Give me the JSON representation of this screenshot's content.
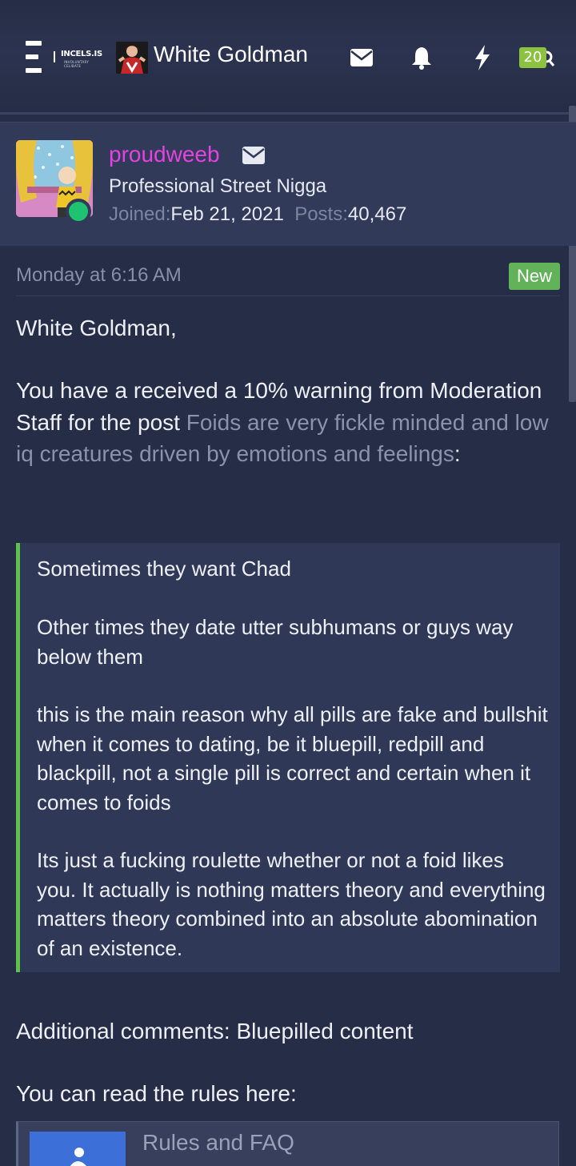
{
  "header": {
    "logo_text": "INCELS.IS",
    "logo_subtext": "INVOLUNTARY CELIBATE",
    "username": "White Goldman",
    "notification_count": "20",
    "icons": [
      "menu-icon",
      "envelope-icon",
      "bell-icon",
      "lightning-icon",
      "search-icon"
    ]
  },
  "message": {
    "poster_name": "proudweeb",
    "poster_title": "Professional Street Nigga",
    "joined_label": "Joined:",
    "joined_value": "Feb 21, 2021",
    "posts_label": "Posts:",
    "posts_value": "40,467",
    "timestamp": "Monday at 6:16 AM",
    "new_label": "New",
    "greeting": "White Goldman,",
    "warning_text": "You have a received a 10% warning from Moderation Staff for the post ",
    "post_link": "Foids are very fickle minded and low iq creatures driven by emotions and feelings",
    "post_link_suffix": ":",
    "quote": {
      "p1": "Sometimes they want Chad",
      "p2": "Other times they date utter subhumans or guys way below them",
      "p3": "this is the main reason why all pills are fake and bullshit when it comes to dating, be it bluepill, redpill and blackpill, not a single pill is correct and certain when it comes to foids",
      "p4": "Its just a fucking roulette whether or not a foid likes you. It actually is nothing matters theory and everything matters theory combined into an absolute abomination of an existence."
    },
    "additional_comments": "Additional comments: Bluepilled content",
    "rules_intro": "You can read the rules here:",
    "rules_card_title": "Rules and FAQ"
  },
  "colors": {
    "background": "#252d47",
    "username_accent": "#e543e0",
    "online": "#1fc271",
    "new_badge": "#62b25a",
    "quote_border": "#5fc14b",
    "count_badge": "#8cc23f"
  }
}
